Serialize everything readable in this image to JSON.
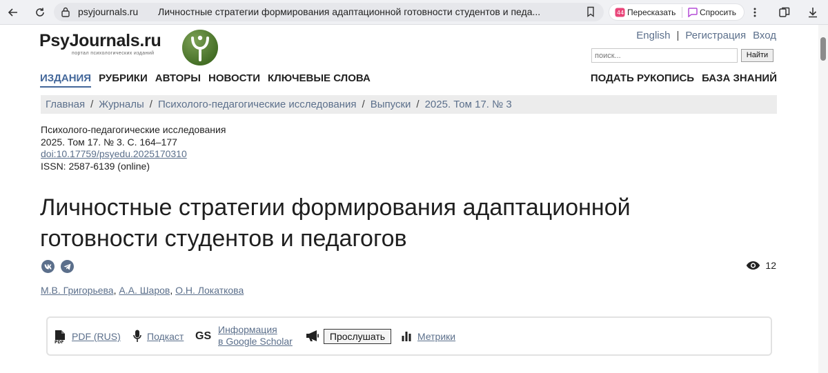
{
  "browser": {
    "domain": "psyjournals.ru",
    "tab_title": "Личностные стратегии формирования адаптационной готовности студентов и педа...",
    "retell_label": "Пересказать",
    "ask_label": "Спросить"
  },
  "site": {
    "logo_text": "PsyJournals.ru",
    "logo_subtitle": "портал психологических изданий",
    "top_links": [
      "English",
      "Регистрация",
      "Вход"
    ],
    "search_placeholder": "поиск...",
    "search_button": "Найти",
    "menu_left": [
      "ИЗДАНИЯ",
      "РУБРИКИ",
      "АВТОРЫ",
      "НОВОСТИ",
      "КЛЮЧЕВЫЕ СЛОВА"
    ],
    "menu_right": [
      "ПОДАТЬ РУКОПИСЬ",
      "БАЗА ЗНАНИЙ"
    ],
    "active_menu": "ИЗДАНИЯ",
    "breadcrumb": [
      "Главная",
      "Журналы",
      "Психолого-педагогические исследования",
      "Выпуски",
      "2025. Том 17. № 3"
    ]
  },
  "article": {
    "journal": "Психолого-педагогические исследования",
    "issue": "2025. Том 17. № 3. С. 164–177",
    "doi": "doi:10.17759/psyedu.2025170310",
    "issn": "ISSN: 2587-6139 (online)",
    "title_line1": "Личностные стратегии формирования адаптационной",
    "title_line2": "готовности студентов и педагогов",
    "views": "12",
    "authors": [
      "М.В. Григорьева",
      "А.А. Шаров",
      "О.Н. Локаткова"
    ]
  },
  "tools": {
    "pdf": "PDF (RUS)",
    "podcast": "Подкаст",
    "gs_label": "GS",
    "scholar_line1": "Информация",
    "scholar_line2": "в Google Scholar",
    "listen": "Прослушать",
    "metrics": "Метрики"
  },
  "colors": {
    "link": "#5b6f8b",
    "accent": "#43679a",
    "logo_green": "#4e7a2c"
  }
}
